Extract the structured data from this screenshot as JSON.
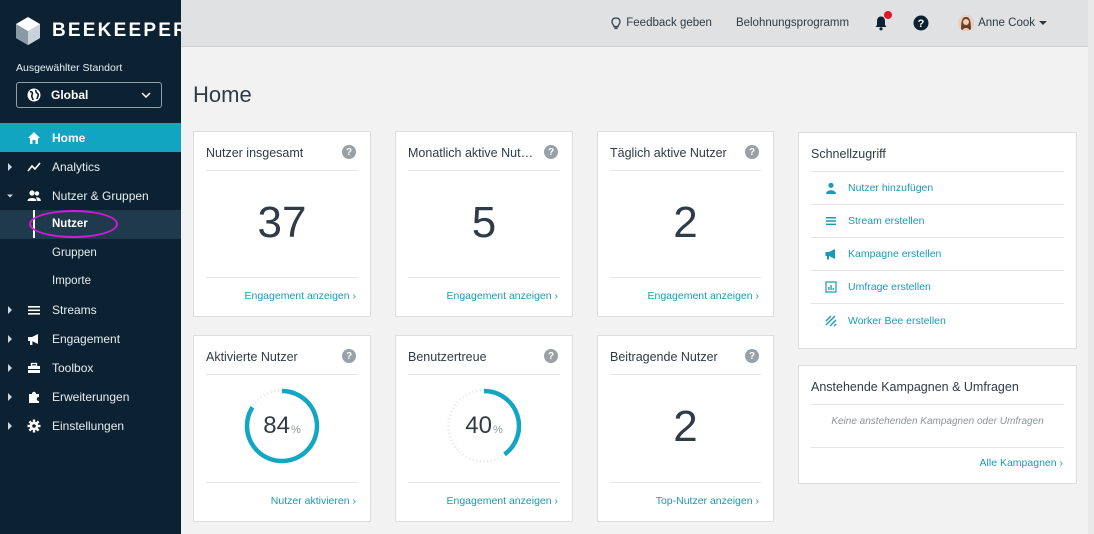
{
  "brand": {
    "name": "BEEKEEPER"
  },
  "location": {
    "label": "Ausgewählter Standort",
    "selected": "Global"
  },
  "nav": {
    "items": [
      {
        "label": "Home",
        "icon": "home-icon",
        "active": true
      },
      {
        "label": "Analytics",
        "icon": "chart-line-icon"
      },
      {
        "label": "Nutzer & Gruppen",
        "icon": "users-icon",
        "expanded": true
      },
      {
        "label": "Streams",
        "icon": "streams-icon"
      },
      {
        "label": "Engagement",
        "icon": "megaphone-icon"
      },
      {
        "label": "Toolbox",
        "icon": "toolbox-icon"
      },
      {
        "label": "Erweiterungen",
        "icon": "puzzle-icon"
      },
      {
        "label": "Einstellungen",
        "icon": "gear-icon"
      }
    ],
    "sub": [
      {
        "label": "Nutzer",
        "selected": true
      },
      {
        "label": "Gruppen"
      },
      {
        "label": "Importe"
      }
    ]
  },
  "topbar": {
    "feedback": "Feedback geben",
    "rewards": "Belohnungsprogramm",
    "user": "Anne Cook"
  },
  "page": {
    "title": "Home"
  },
  "cards": {
    "total_users": {
      "title": "Nutzer insgesamt",
      "value": "37",
      "link": "Engagement anzeigen ›"
    },
    "monthly_active": {
      "title": "Monatlich aktive Nutzer",
      "value": "5",
      "link": "Engagement anzeigen ›"
    },
    "daily_active": {
      "title": "Täglich aktive Nutzer",
      "value": "2",
      "link": "Engagement anzeigen ›"
    },
    "activated": {
      "title": "Aktivierte Nutzer",
      "value": "84",
      "unit": "%",
      "link": "Nutzer aktivieren ›"
    },
    "loyalty": {
      "title": "Benutzertreue",
      "value": "40",
      "unit": "%",
      "link": "Engagement anzeigen ›"
    },
    "contributing": {
      "title": "Beitragende Nutzer",
      "value": "2",
      "link": "Top-Nutzer anzeigen ›"
    }
  },
  "quick_access": {
    "title": "Schnellzugriff",
    "items": [
      {
        "label": "Nutzer hinzufügen",
        "icon": "user-icon"
      },
      {
        "label": "Stream erstellen",
        "icon": "list-icon"
      },
      {
        "label": "Kampagne erstellen",
        "icon": "megaphone-icon"
      },
      {
        "label": "Umfrage erstellen",
        "icon": "survey-icon"
      },
      {
        "label": "Worker Bee erstellen",
        "icon": "worker-bee-icon"
      }
    ]
  },
  "pending": {
    "title": "Anstehende Kampagnen & Umfragen",
    "empty": "Keine anstehenden Kampagnen oder Umfragen",
    "link": "Alle Kampagnen ›"
  },
  "colors": {
    "accent": "#12a5c2",
    "sidebar": "#0c2233",
    "link": "#1a9ab5",
    "gauge": "#13a6c3"
  },
  "gauges": {
    "activated_fraction": 0.84,
    "loyalty_fraction": 0.4
  }
}
